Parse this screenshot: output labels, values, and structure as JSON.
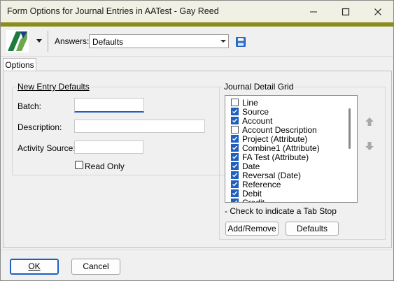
{
  "window": {
    "title": "Form Options for Journal Entries in AATest - Gay Reed",
    "minimize_icon": "minimize-icon",
    "maximize_icon": "maximize-icon",
    "close_icon": "close-icon"
  },
  "toolbar": {
    "answers_label": "Answers:",
    "answers_value": "Defaults",
    "accent_color": "#8b8b1e",
    "brand_color": "#1f7a3f"
  },
  "tabs": [
    {
      "label": "Options",
      "selected": true
    }
  ],
  "new_entry_defaults": {
    "title": "New Entry Defaults",
    "batch_label": "Batch:",
    "batch_value": "",
    "description_label": "Description:",
    "description_value": "",
    "activity_source_label": "Activity Source:",
    "activity_source_value": "",
    "read_only_label": "Read Only",
    "read_only_checked": false
  },
  "journal_detail_grid": {
    "title": "Journal Detail Grid",
    "items": [
      {
        "label": "Line",
        "checked": false
      },
      {
        "label": "Source",
        "checked": true
      },
      {
        "label": "Account",
        "checked": true
      },
      {
        "label": "Account Description",
        "checked": false
      },
      {
        "label": "Project (Attribute)",
        "checked": true
      },
      {
        "label": "Combine1 (Attribute)",
        "checked": true
      },
      {
        "label": "FA Test (Attribute)",
        "checked": true
      },
      {
        "label": "Date",
        "checked": true
      },
      {
        "label": "Reversal (Date)",
        "checked": true
      },
      {
        "label": "Reference",
        "checked": true
      },
      {
        "label": "Debit",
        "checked": true
      },
      {
        "label": "Credit",
        "checked": true
      }
    ],
    "hint": "- Check to indicate a Tab Stop",
    "add_remove_label": "Add/Remove",
    "defaults_label": "Defaults"
  },
  "footer": {
    "ok_label": "OK",
    "cancel_label": "Cancel"
  }
}
